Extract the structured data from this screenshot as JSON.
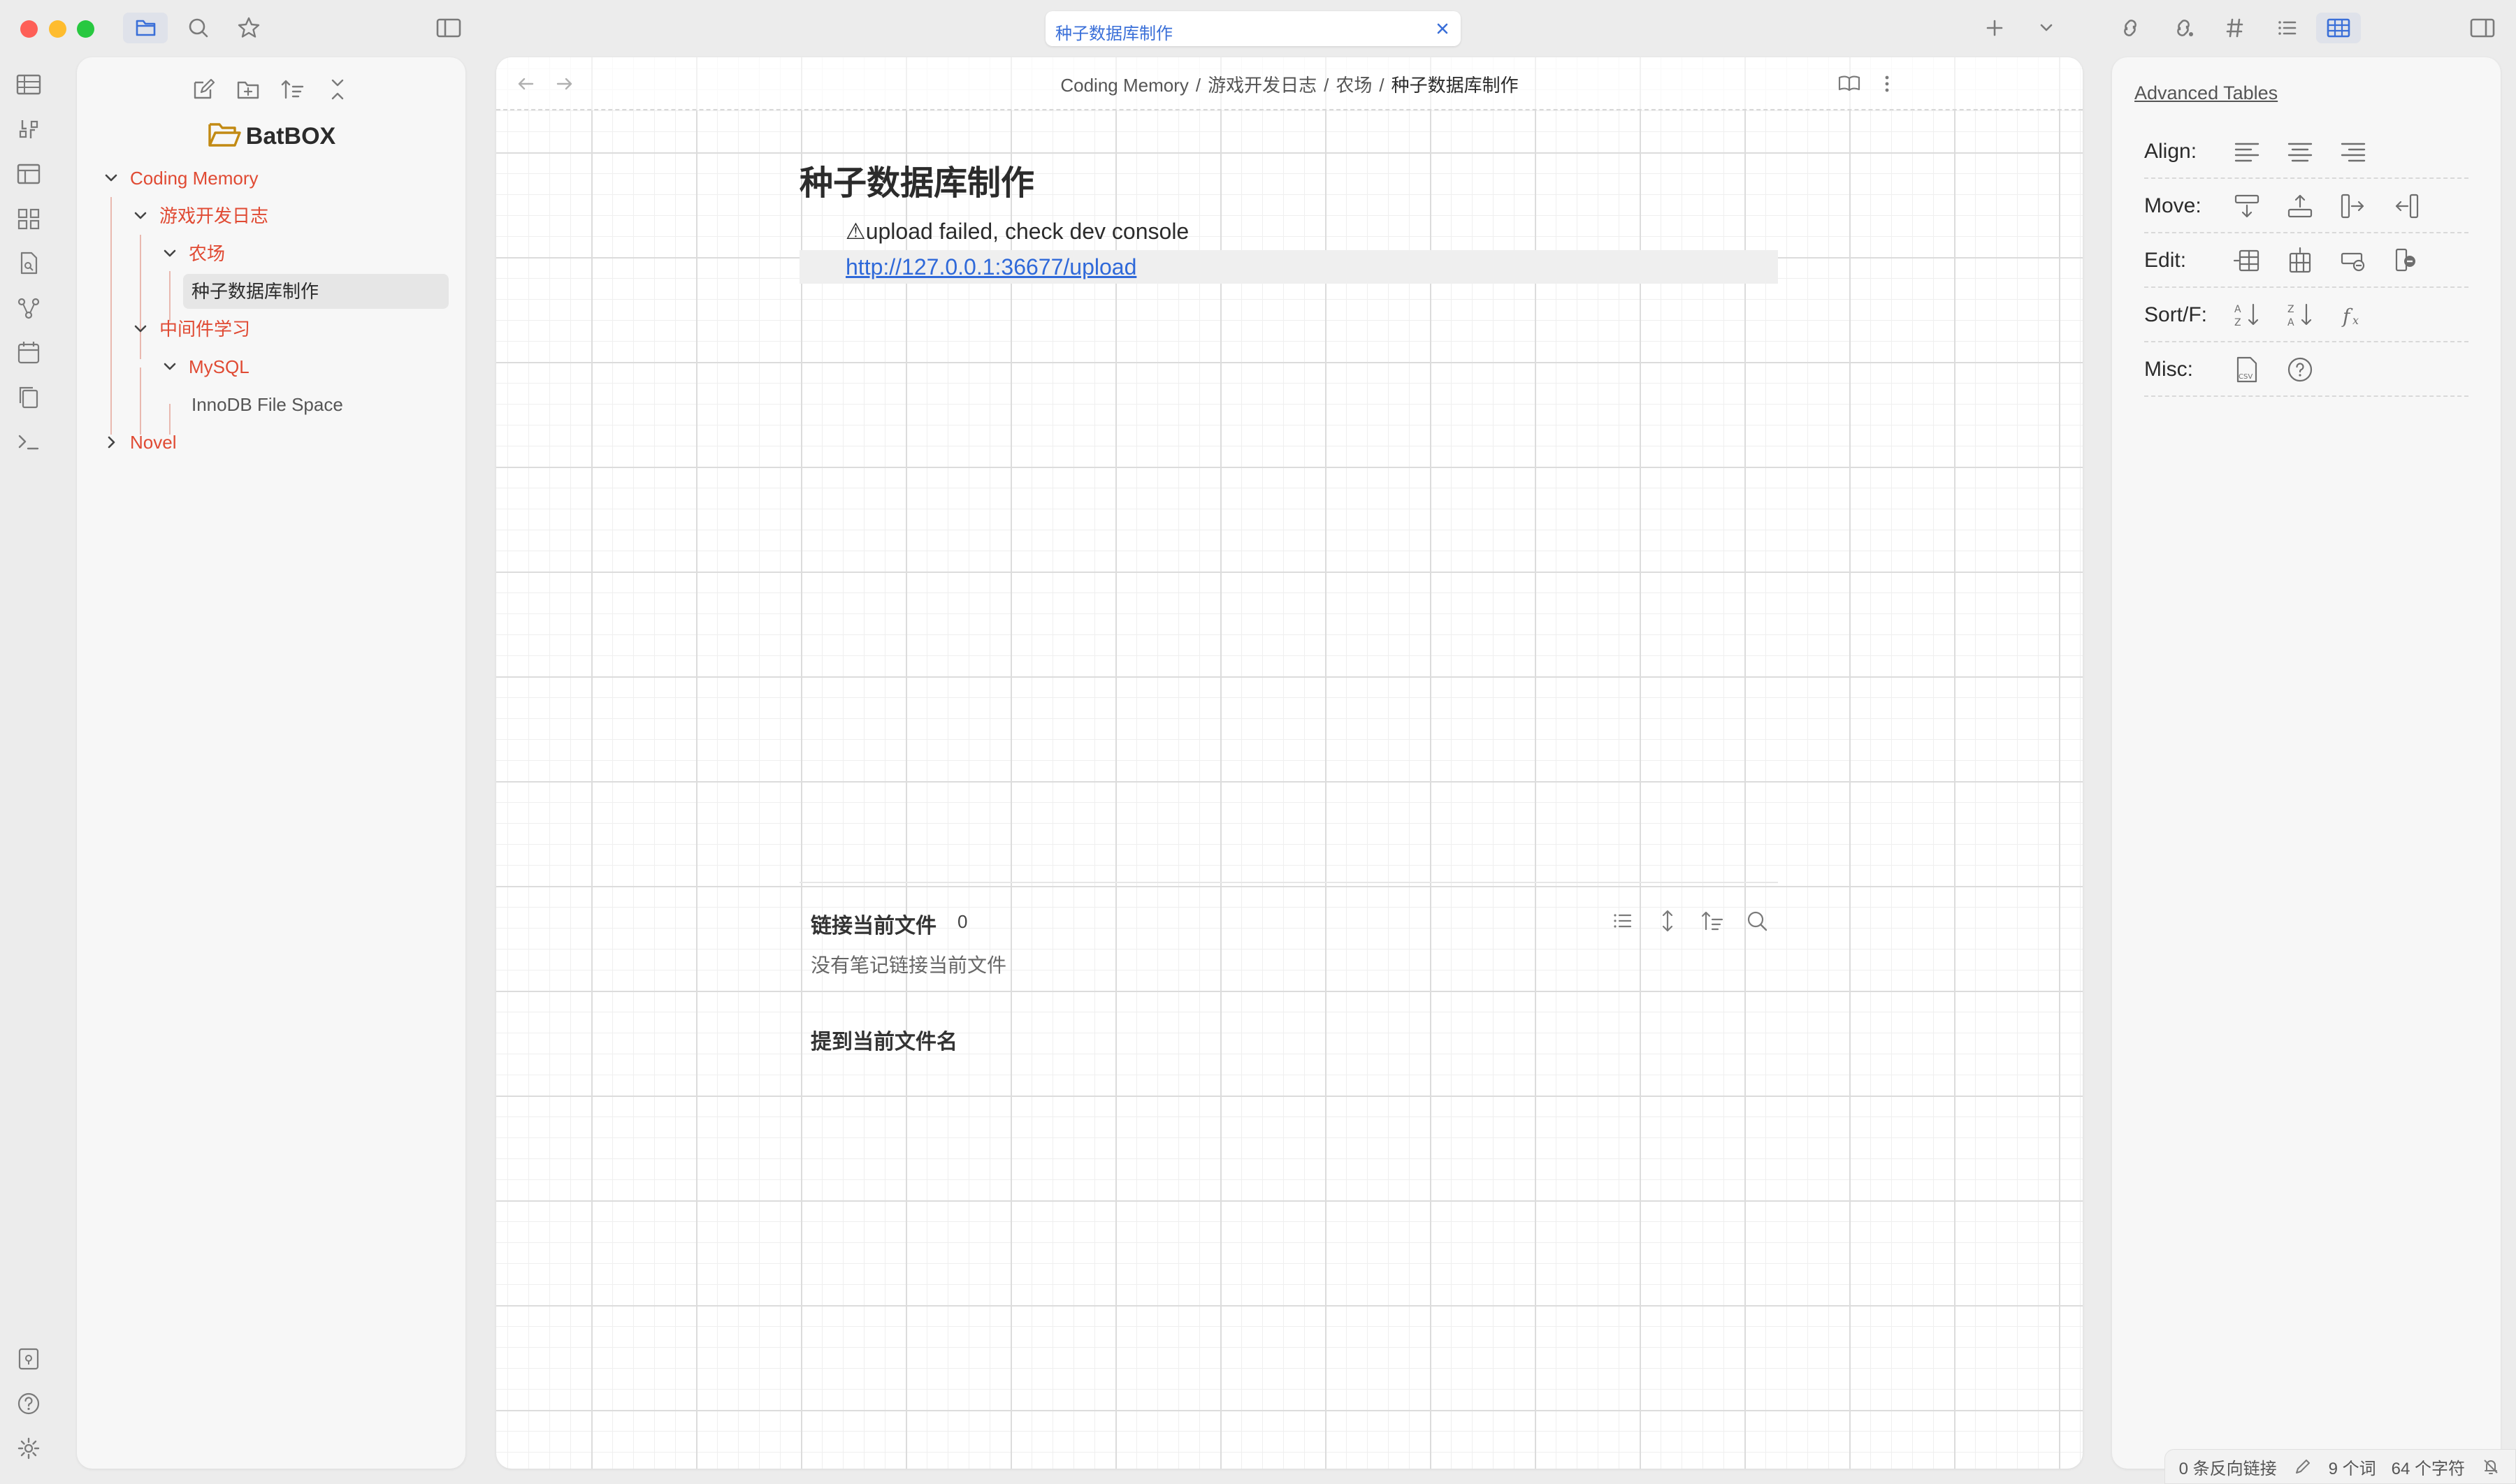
{
  "tab": {
    "title": "种子数据库制作"
  },
  "explorer": {
    "vault_name": "BatBOX",
    "tree": [
      {
        "label": "Coding Memory",
        "type": "folder"
      },
      {
        "label": "游戏开发日志",
        "type": "folder"
      },
      {
        "label": "农场",
        "type": "folder"
      },
      {
        "label": "种子数据库制作",
        "type": "file"
      },
      {
        "label": "中间件学习",
        "type": "folder"
      },
      {
        "label": "MySQL",
        "type": "folder"
      },
      {
        "label": "InnoDB File Space",
        "type": "file"
      },
      {
        "label": "Novel",
        "type": "folder"
      }
    ]
  },
  "editor": {
    "breadcrumb": [
      "Coding Memory",
      "游戏开发日志",
      "农场",
      "种子数据库制作"
    ],
    "title": "种子数据库制作",
    "upload_message": "⚠upload failed, check dev console",
    "upload_url": "http://127.0.0.1:36677/upload",
    "backlinks": {
      "title": "链接当前文件",
      "count": "0",
      "empty_text": "没有笔记链接当前文件",
      "unlinked_title": "提到当前文件名"
    }
  },
  "advanced_tables": {
    "title": "Advanced Tables",
    "rows": [
      {
        "label": "Align:"
      },
      {
        "label": "Move:"
      },
      {
        "label": "Edit:"
      },
      {
        "label": "Sort/F:"
      },
      {
        "label": "Misc:"
      }
    ]
  },
  "statusbar": {
    "backlinks": "0 条反向链接",
    "words": "9 个词",
    "chars": "64 个字符"
  },
  "colors": {
    "accent": "#3a6fd8",
    "folder_text": "#e04a33",
    "link": "#2f69d9",
    "vault_icon": "#c28a13"
  }
}
